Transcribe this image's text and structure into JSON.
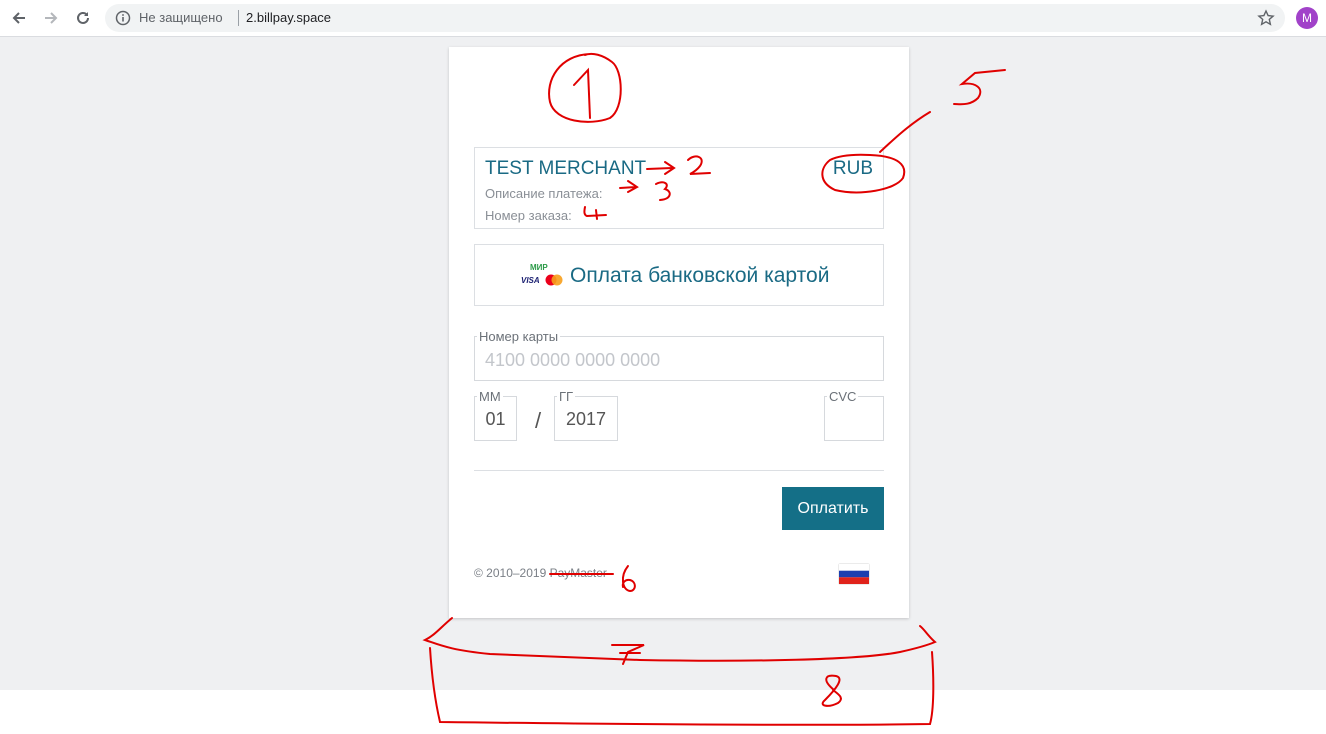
{
  "browser": {
    "security_label": "Не защищено",
    "url": "2.billpay.space",
    "avatar_initial": "M"
  },
  "payment": {
    "merchant_name": "TEST MERCHANT",
    "currency": "RUB",
    "description_label": "Описание платежа:",
    "order_label": "Номер заказа:",
    "method_title": "Оплата банковской картой",
    "logos": {
      "mir": "МИР",
      "visa": "VISA"
    },
    "card_number_label": "Номер карты",
    "card_number_placeholder": "4100 0000 0000 0000",
    "month_label": "ММ",
    "month_value": "01",
    "separator": "/",
    "year_label": "ГГ",
    "year_value": "2017",
    "cvc_label": "CVC",
    "cvc_value": "",
    "pay_button": "Оплатить",
    "copyright": "© 2010–2019 PayMaster"
  },
  "annotations": {
    "labels": [
      "1",
      "2",
      "3",
      "4",
      "5",
      "6",
      "7",
      "8"
    ],
    "color": "#e00000"
  },
  "colors": {
    "accent": "#146f87",
    "heading": "#1a6a84",
    "page_background": "#eff0f2"
  }
}
